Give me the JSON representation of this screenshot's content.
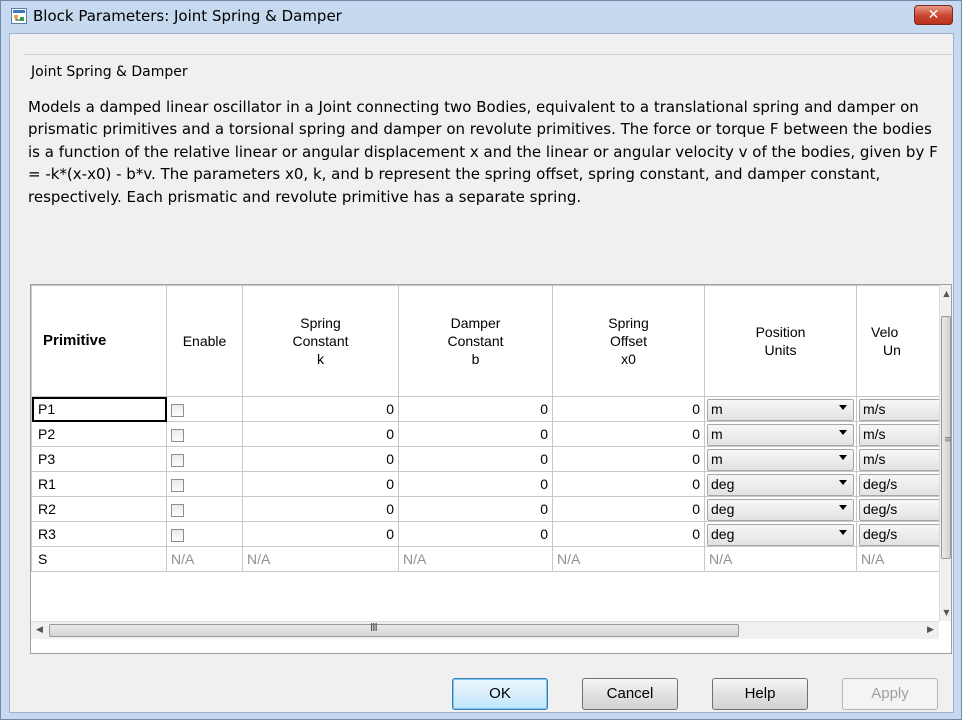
{
  "window": {
    "title": "Block Parameters: Joint Spring & Damper",
    "close_glyph": "✕"
  },
  "group": {
    "label": "Joint Spring & Damper",
    "description": "Models a damped linear oscillator in a Joint connecting two Bodies, equivalent to a translational spring and damper on prismatic primitives and a torsional spring and damper on revolute primitives. The force or torque F between the bodies is a function of the relative linear or angular displacement x and the linear or angular velocity v of the bodies, given by F = -k*(x-x0) - b*v. The parameters x0, k, and b represent the spring offset, spring constant, and damper constant, respectively. Each prismatic and revolute primitive has a separate spring."
  },
  "table": {
    "headers": {
      "primitive": "Primitive",
      "enable": "Enable",
      "spring_constant": [
        "Spring",
        "Constant",
        "k"
      ],
      "damper_constant": [
        "Damper",
        "Constant",
        "b"
      ],
      "spring_offset": [
        "Spring",
        "Offset",
        "x0"
      ],
      "position_units": [
        "Position",
        "Units"
      ],
      "velocity_units": [
        "Velo",
        "Un"
      ]
    },
    "rows": [
      {
        "primitive": "P1",
        "enabled": false,
        "k": "0",
        "b": "0",
        "x0": "0",
        "pos_units": "m",
        "vel_units": "m/s"
      },
      {
        "primitive": "P2",
        "enabled": false,
        "k": "0",
        "b": "0",
        "x0": "0",
        "pos_units": "m",
        "vel_units": "m/s"
      },
      {
        "primitive": "P3",
        "enabled": false,
        "k": "0",
        "b": "0",
        "x0": "0",
        "pos_units": "m",
        "vel_units": "m/s"
      },
      {
        "primitive": "R1",
        "enabled": false,
        "k": "0",
        "b": "0",
        "x0": "0",
        "pos_units": "deg",
        "vel_units": "deg/s"
      },
      {
        "primitive": "R2",
        "enabled": false,
        "k": "0",
        "b": "0",
        "x0": "0",
        "pos_units": "deg",
        "vel_units": "deg/s"
      },
      {
        "primitive": "R3",
        "enabled": false,
        "k": "0",
        "b": "0",
        "x0": "0",
        "pos_units": "deg",
        "vel_units": "deg/s"
      }
    ],
    "na_row": {
      "primitive": "S",
      "na": "N/A"
    },
    "hscroll_grip": "III",
    "vscroll_grip": "≡"
  },
  "buttons": {
    "ok": "OK",
    "cancel": "Cancel",
    "help": "Help",
    "apply": "Apply"
  },
  "icons": {
    "app": "block-parameters-icon",
    "close": "close-icon",
    "dropdown": "chevron-down-icon",
    "scroll_up": "▲",
    "scroll_down": "▼",
    "scroll_left": "◀",
    "scroll_right": "▶"
  },
  "colors": {
    "titlebar": "#c6d9ef",
    "close_button": "#c9452f",
    "dialog_bg": "#f0f0f0",
    "na_text": "#909090"
  }
}
